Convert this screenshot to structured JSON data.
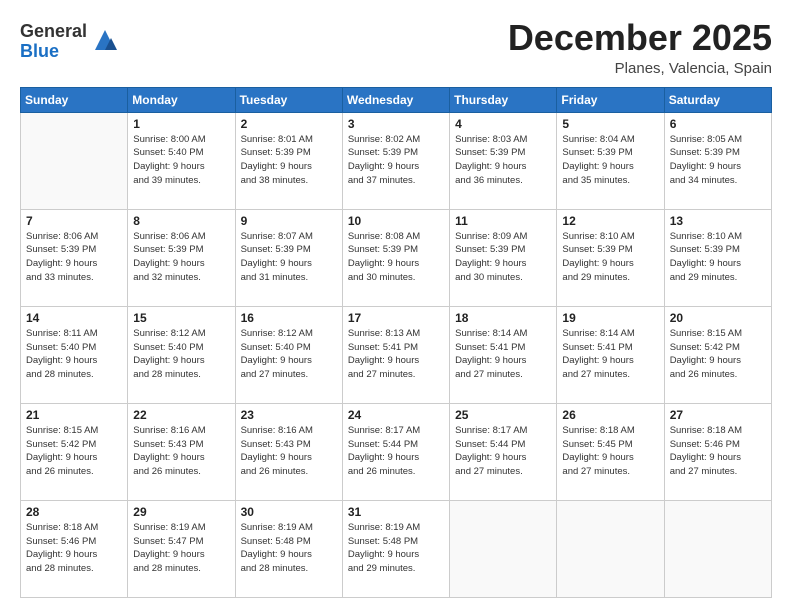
{
  "header": {
    "logo_general": "General",
    "logo_blue": "Blue",
    "month": "December 2025",
    "location": "Planes, Valencia, Spain"
  },
  "days_of_week": [
    "Sunday",
    "Monday",
    "Tuesday",
    "Wednesday",
    "Thursday",
    "Friday",
    "Saturday"
  ],
  "weeks": [
    [
      {
        "num": "",
        "info": ""
      },
      {
        "num": "1",
        "info": "Sunrise: 8:00 AM\nSunset: 5:40 PM\nDaylight: 9 hours\nand 39 minutes."
      },
      {
        "num": "2",
        "info": "Sunrise: 8:01 AM\nSunset: 5:39 PM\nDaylight: 9 hours\nand 38 minutes."
      },
      {
        "num": "3",
        "info": "Sunrise: 8:02 AM\nSunset: 5:39 PM\nDaylight: 9 hours\nand 37 minutes."
      },
      {
        "num": "4",
        "info": "Sunrise: 8:03 AM\nSunset: 5:39 PM\nDaylight: 9 hours\nand 36 minutes."
      },
      {
        "num": "5",
        "info": "Sunrise: 8:04 AM\nSunset: 5:39 PM\nDaylight: 9 hours\nand 35 minutes."
      },
      {
        "num": "6",
        "info": "Sunrise: 8:05 AM\nSunset: 5:39 PM\nDaylight: 9 hours\nand 34 minutes."
      }
    ],
    [
      {
        "num": "7",
        "info": "Sunrise: 8:06 AM\nSunset: 5:39 PM\nDaylight: 9 hours\nand 33 minutes."
      },
      {
        "num": "8",
        "info": "Sunrise: 8:06 AM\nSunset: 5:39 PM\nDaylight: 9 hours\nand 32 minutes."
      },
      {
        "num": "9",
        "info": "Sunrise: 8:07 AM\nSunset: 5:39 PM\nDaylight: 9 hours\nand 31 minutes."
      },
      {
        "num": "10",
        "info": "Sunrise: 8:08 AM\nSunset: 5:39 PM\nDaylight: 9 hours\nand 30 minutes."
      },
      {
        "num": "11",
        "info": "Sunrise: 8:09 AM\nSunset: 5:39 PM\nDaylight: 9 hours\nand 30 minutes."
      },
      {
        "num": "12",
        "info": "Sunrise: 8:10 AM\nSunset: 5:39 PM\nDaylight: 9 hours\nand 29 minutes."
      },
      {
        "num": "13",
        "info": "Sunrise: 8:10 AM\nSunset: 5:39 PM\nDaylight: 9 hours\nand 29 minutes."
      }
    ],
    [
      {
        "num": "14",
        "info": "Sunrise: 8:11 AM\nSunset: 5:40 PM\nDaylight: 9 hours\nand 28 minutes."
      },
      {
        "num": "15",
        "info": "Sunrise: 8:12 AM\nSunset: 5:40 PM\nDaylight: 9 hours\nand 28 minutes."
      },
      {
        "num": "16",
        "info": "Sunrise: 8:12 AM\nSunset: 5:40 PM\nDaylight: 9 hours\nand 27 minutes."
      },
      {
        "num": "17",
        "info": "Sunrise: 8:13 AM\nSunset: 5:41 PM\nDaylight: 9 hours\nand 27 minutes."
      },
      {
        "num": "18",
        "info": "Sunrise: 8:14 AM\nSunset: 5:41 PM\nDaylight: 9 hours\nand 27 minutes."
      },
      {
        "num": "19",
        "info": "Sunrise: 8:14 AM\nSunset: 5:41 PM\nDaylight: 9 hours\nand 27 minutes."
      },
      {
        "num": "20",
        "info": "Sunrise: 8:15 AM\nSunset: 5:42 PM\nDaylight: 9 hours\nand 26 minutes."
      }
    ],
    [
      {
        "num": "21",
        "info": "Sunrise: 8:15 AM\nSunset: 5:42 PM\nDaylight: 9 hours\nand 26 minutes."
      },
      {
        "num": "22",
        "info": "Sunrise: 8:16 AM\nSunset: 5:43 PM\nDaylight: 9 hours\nand 26 minutes."
      },
      {
        "num": "23",
        "info": "Sunrise: 8:16 AM\nSunset: 5:43 PM\nDaylight: 9 hours\nand 26 minutes."
      },
      {
        "num": "24",
        "info": "Sunrise: 8:17 AM\nSunset: 5:44 PM\nDaylight: 9 hours\nand 26 minutes."
      },
      {
        "num": "25",
        "info": "Sunrise: 8:17 AM\nSunset: 5:44 PM\nDaylight: 9 hours\nand 27 minutes."
      },
      {
        "num": "26",
        "info": "Sunrise: 8:18 AM\nSunset: 5:45 PM\nDaylight: 9 hours\nand 27 minutes."
      },
      {
        "num": "27",
        "info": "Sunrise: 8:18 AM\nSunset: 5:46 PM\nDaylight: 9 hours\nand 27 minutes."
      }
    ],
    [
      {
        "num": "28",
        "info": "Sunrise: 8:18 AM\nSunset: 5:46 PM\nDaylight: 9 hours\nand 28 minutes."
      },
      {
        "num": "29",
        "info": "Sunrise: 8:19 AM\nSunset: 5:47 PM\nDaylight: 9 hours\nand 28 minutes."
      },
      {
        "num": "30",
        "info": "Sunrise: 8:19 AM\nSunset: 5:48 PM\nDaylight: 9 hours\nand 28 minutes."
      },
      {
        "num": "31",
        "info": "Sunrise: 8:19 AM\nSunset: 5:48 PM\nDaylight: 9 hours\nand 29 minutes."
      },
      {
        "num": "",
        "info": ""
      },
      {
        "num": "",
        "info": ""
      },
      {
        "num": "",
        "info": ""
      }
    ]
  ]
}
